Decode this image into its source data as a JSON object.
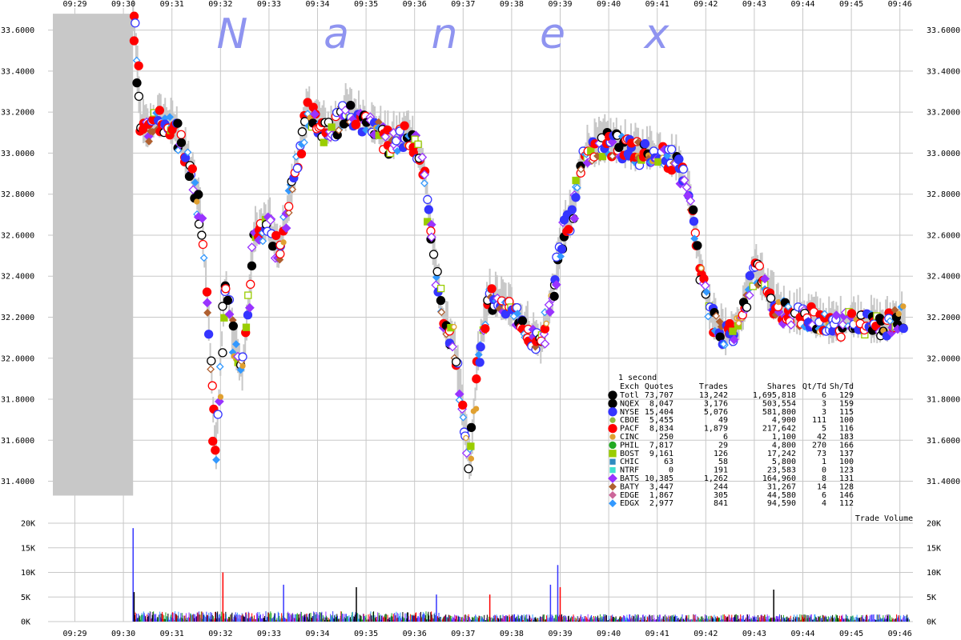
{
  "watermark": [
    "N",
    "a",
    "n",
    "e",
    "x"
  ],
  "colors": {
    "background": "#ffffff",
    "grid": "#c8c8c8",
    "shade": "#c8c8c8",
    "watermark": "#8f94f0"
  },
  "chart_data": [
    {
      "type": "scatter",
      "time_ticks": [
        "09:29",
        "09:30",
        "09:31",
        "09:32",
        "09:33",
        "09:34",
        "09:35",
        "09:36",
        "09:37",
        "09:38",
        "09:39",
        "09:40",
        "09:41",
        "09:42",
        "09:43",
        "09:44",
        "09:45",
        "09:46"
      ],
      "y_ticks": [
        "31.4000",
        "31.6000",
        "31.8000",
        "32.0000",
        "32.2000",
        "32.4000",
        "32.6000",
        "32.8000",
        "33.0000",
        "33.2000",
        "33.4000",
        "33.6000"
      ],
      "ylim": [
        31.25,
        33.7
      ],
      "xlim_minutes": [
        0,
        17.6
      ],
      "grid": true,
      "price_path": [
        {
          "t": 1.2,
          "p": 33.66
        },
        {
          "t": 1.27,
          "p": 33.45
        },
        {
          "t": 1.35,
          "p": 33.15
        },
        {
          "t": 1.5,
          "p": 33.1
        },
        {
          "t": 1.7,
          "p": 33.16
        },
        {
          "t": 1.9,
          "p": 33.15
        },
        {
          "t": 2.1,
          "p": 33.1
        },
        {
          "t": 2.4,
          "p": 32.9
        },
        {
          "t": 2.6,
          "p": 32.7
        },
        {
          "t": 2.75,
          "p": 32.2
        },
        {
          "t": 2.9,
          "p": 31.5
        },
        {
          "t": 3.1,
          "p": 32.4
        },
        {
          "t": 3.25,
          "p": 32.1
        },
        {
          "t": 3.45,
          "p": 31.9
        },
        {
          "t": 3.7,
          "p": 32.6
        },
        {
          "t": 4.0,
          "p": 32.65
        },
        {
          "t": 4.2,
          "p": 32.5
        },
        {
          "t": 4.5,
          "p": 32.85
        },
        {
          "t": 4.8,
          "p": 33.2
        },
        {
          "t": 5.2,
          "p": 33.1
        },
        {
          "t": 5.6,
          "p": 33.2
        },
        {
          "t": 6.0,
          "p": 33.15
        },
        {
          "t": 6.5,
          "p": 33.05
        },
        {
          "t": 6.9,
          "p": 33.1
        },
        {
          "t": 7.2,
          "p": 32.9
        },
        {
          "t": 7.4,
          "p": 32.5
        },
        {
          "t": 7.6,
          "p": 32.15
        },
        {
          "t": 7.8,
          "p": 32.1
        },
        {
          "t": 7.95,
          "p": 31.8
        },
        {
          "t": 8.15,
          "p": 31.45
        },
        {
          "t": 8.3,
          "p": 32.0
        },
        {
          "t": 8.55,
          "p": 32.3
        },
        {
          "t": 8.9,
          "p": 32.25
        },
        {
          "t": 9.3,
          "p": 32.15
        },
        {
          "t": 9.6,
          "p": 32.05
        },
        {
          "t": 9.85,
          "p": 32.3
        },
        {
          "t": 10.05,
          "p": 32.6
        },
        {
          "t": 10.25,
          "p": 32.7
        },
        {
          "t": 10.5,
          "p": 33.0
        },
        {
          "t": 11.0,
          "p": 33.05
        },
        {
          "t": 11.5,
          "p": 33.0
        },
        {
          "t": 12.0,
          "p": 33.0
        },
        {
          "t": 12.4,
          "p": 32.95
        },
        {
          "t": 12.65,
          "p": 32.8
        },
        {
          "t": 12.85,
          "p": 32.5
        },
        {
          "t": 13.1,
          "p": 32.2
        },
        {
          "t": 13.4,
          "p": 32.1
        },
        {
          "t": 13.7,
          "p": 32.15
        },
        {
          "t": 14.0,
          "p": 32.45
        },
        {
          "t": 14.3,
          "p": 32.3
        },
        {
          "t": 14.7,
          "p": 32.2
        },
        {
          "t": 15.1,
          "p": 32.2
        },
        {
          "t": 15.6,
          "p": 32.15
        },
        {
          "t": 16.1,
          "p": 32.18
        },
        {
          "t": 16.6,
          "p": 32.15
        },
        {
          "t": 17.1,
          "p": 32.2
        }
      ],
      "pre_open_range": {
        "t_start": 0,
        "t_end": 1.2,
        "low": 31.33,
        "high": 33.68
      },
      "stats": {
        "interval": "1 second",
        "columns": [
          "Exch",
          "Quotes",
          "Trades",
          "Shares",
          "Qt/Td",
          "Sh/Td"
        ],
        "rows": [
          {
            "exch": "Totl",
            "quotes": "73,707",
            "trades": "13,242",
            "shares": "1,695,818",
            "qt_td": "6",
            "sh_td": "129",
            "color": "#000000",
            "marker": "circle-lg"
          },
          {
            "exch": "NQEX",
            "quotes": "8,047",
            "trades": "3,176",
            "shares": "503,554",
            "qt_td": "3",
            "sh_td": "159",
            "color": "#000000",
            "marker": "circle-lg"
          },
          {
            "exch": "NYSE",
            "quotes": "15,404",
            "trades": "5,076",
            "shares": "581,800",
            "qt_td": "3",
            "sh_td": "115",
            "color": "#3535ff",
            "marker": "circle-lg"
          },
          {
            "exch": "CBOE",
            "quotes": "5,455",
            "trades": "49",
            "shares": "4,900",
            "qt_td": "111",
            "sh_td": "100",
            "color": "#8fbc3f",
            "marker": "circle-sm"
          },
          {
            "exch": "PACF",
            "quotes": "8,834",
            "trades": "1,879",
            "shares": "217,642",
            "qt_td": "5",
            "sh_td": "116",
            "color": "#ff0000",
            "marker": "circle-lg"
          },
          {
            "exch": "CINC",
            "quotes": "250",
            "trades": "6",
            "shares": "1,100",
            "qt_td": "42",
            "sh_td": "183",
            "color": "#e0a030",
            "marker": "circle-sm"
          },
          {
            "exch": "PHIL",
            "quotes": "7,817",
            "trades": "29",
            "shares": "4,800",
            "qt_td": "270",
            "sh_td": "166",
            "color": "#22aa22",
            "marker": "circle-md"
          },
          {
            "exch": "BOST",
            "quotes": "9,161",
            "trades": "126",
            "shares": "17,242",
            "qt_td": "73",
            "sh_td": "137",
            "color": "#9acd00",
            "marker": "square"
          },
          {
            "exch": "CHIC",
            "quotes": "63",
            "trades": "58",
            "shares": "5,800",
            "qt_td": "1",
            "sh_td": "100",
            "color": "#2e8bc0",
            "marker": "square-sm"
          },
          {
            "exch": "NTRF",
            "quotes": "0",
            "trades": "191",
            "shares": "23,583",
            "qt_td": "0",
            "sh_td": "123",
            "color": "#40e0d0",
            "marker": "square-sm"
          },
          {
            "exch": "BATS",
            "quotes": "10,385",
            "trades": "1,262",
            "shares": "164,960",
            "qt_td": "8",
            "sh_td": "131",
            "color": "#9933ff",
            "marker": "diamond"
          },
          {
            "exch": "BATY",
            "quotes": "3,447",
            "trades": "244",
            "shares": "31,267",
            "qt_td": "14",
            "sh_td": "128",
            "color": "#b06030",
            "marker": "diamond-sm"
          },
          {
            "exch": "EDGE",
            "quotes": "1,867",
            "trades": "305",
            "shares": "44,580",
            "qt_td": "6",
            "sh_td": "146",
            "color": "#cc6699",
            "marker": "diamond-sm"
          },
          {
            "exch": "EDGX",
            "quotes": "2,977",
            "trades": "841",
            "shares": "94,590",
            "qt_td": "4",
            "sh_td": "112",
            "color": "#3399ff",
            "marker": "diamond-sm"
          }
        ]
      }
    },
    {
      "type": "bar",
      "title": "Trade Volume",
      "y_ticks": [
        "0K",
        "5K",
        "10K",
        "15K",
        "20K"
      ],
      "ylim": [
        0,
        20000
      ],
      "spikes": [
        {
          "t": 1.2,
          "v": 19000,
          "color": "#3535ff"
        },
        {
          "t": 1.22,
          "v": 6000,
          "color": "#000000"
        },
        {
          "t": 3.05,
          "v": 10000,
          "color": "#ff0000"
        },
        {
          "t": 4.3,
          "v": 7500,
          "color": "#3535ff"
        },
        {
          "t": 5.8,
          "v": 7000,
          "color": "#000000"
        },
        {
          "t": 7.45,
          "v": 5500,
          "color": "#3535ff"
        },
        {
          "t": 8.55,
          "v": 5500,
          "color": "#ff0000"
        },
        {
          "t": 9.8,
          "v": 7500,
          "color": "#3535ff"
        },
        {
          "t": 9.95,
          "v": 11500,
          "color": "#3535ff"
        },
        {
          "t": 10.0,
          "v": 7000,
          "color": "#ff0000"
        },
        {
          "t": 14.4,
          "v": 6500,
          "color": "#000000"
        }
      ]
    }
  ]
}
